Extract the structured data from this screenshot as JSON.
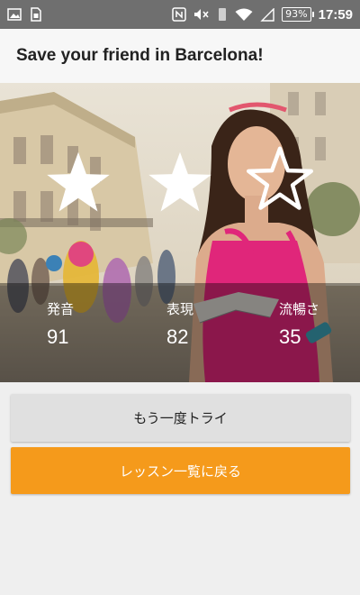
{
  "status_bar": {
    "battery": "93%",
    "time": "17:59",
    "icons": [
      "image-icon",
      "sim-card-icon",
      "nfc-icon",
      "mute-icon",
      "vibrate-icon",
      "wifi-icon",
      "signal-icon"
    ]
  },
  "app_bar": {
    "title": "Save your friend in Barcelona!"
  },
  "results": {
    "stars": [
      {
        "name": "star-1",
        "state": "filled"
      },
      {
        "name": "star-2",
        "state": "filled"
      },
      {
        "name": "star-3",
        "state": "outline"
      }
    ],
    "scores": [
      {
        "label": "発音",
        "value": "91"
      },
      {
        "label": "表現",
        "value": "82"
      },
      {
        "label": "流暢さ",
        "value": "35"
      }
    ]
  },
  "buttons": {
    "retry_label": "もう一度トライ",
    "back_label": "レッスン一覧に戻る"
  },
  "colors": {
    "accent": "#f59a1b",
    "status_bar": "#6f6f6f",
    "app_bar": "#f7f7f7"
  }
}
